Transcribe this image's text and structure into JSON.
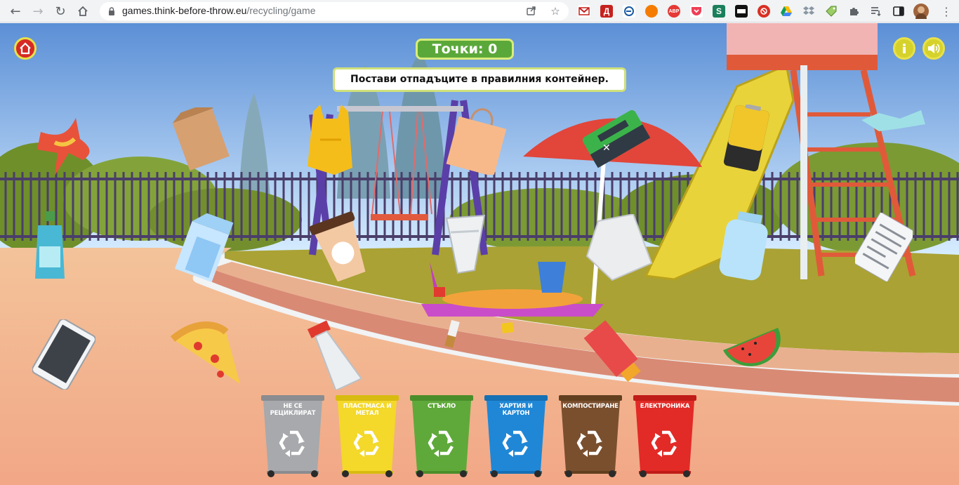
{
  "browser": {
    "url_host": "games.think-before-throw.eu",
    "url_path": "/recycling/game",
    "extensions": [
      "gmail-icon",
      "d-extension-icon",
      "eurostat-icon",
      "orange-extension-icon",
      "adblock-icon",
      "pocket-icon",
      "s-extension-icon",
      "film-icon",
      "red-extension-icon",
      "drive-icon",
      "dropbox-icon",
      "tag-icon",
      "puzzle-icon",
      "reading-list-icon",
      "sidepanel-icon",
      "profile-avatar",
      "menu-icon"
    ],
    "ext_labels": {
      "d": "Д",
      "abp": "ABP",
      "s": "S"
    }
  },
  "game": {
    "score_label": "Точки: 0",
    "instruction": "Постави отпадъците в правилния контейнер.",
    "close_symbol": "✕"
  },
  "bins": [
    {
      "label": "Не се рециклират",
      "color": "#a7a9ac",
      "dark": "#8a8c8f"
    },
    {
      "label": "Пластмаса и метал",
      "color": "#f4d82a",
      "dark": "#d8bb10"
    },
    {
      "label": "Стъкло",
      "color": "#5fa93a",
      "dark": "#4a8e2a"
    },
    {
      "label": "Хартия и картон",
      "color": "#1f87d6",
      "dark": "#1670b4"
    },
    {
      "label": "Компостиране",
      "color": "#7a4f2e",
      "dark": "#62401f"
    },
    {
      "label": "Електроника",
      "color": "#e22a26",
      "dark": "#c01c18"
    }
  ],
  "items": [
    "apple-core",
    "paper-bag",
    "plastic-bag",
    "shopping-bag",
    "battery-green",
    "battery-yellow",
    "plastic-bottle-crushed",
    "detergent-bottle",
    "milk-carton",
    "coffee-cup",
    "plastic-cup",
    "sand-toys",
    "glass-jar-white",
    "glass-jar-blue",
    "newspaper",
    "tablet",
    "pizza-slice",
    "spray-bottle",
    "cigarette-butt",
    "candy-wrapper",
    "tube",
    "watermelon-slice"
  ]
}
